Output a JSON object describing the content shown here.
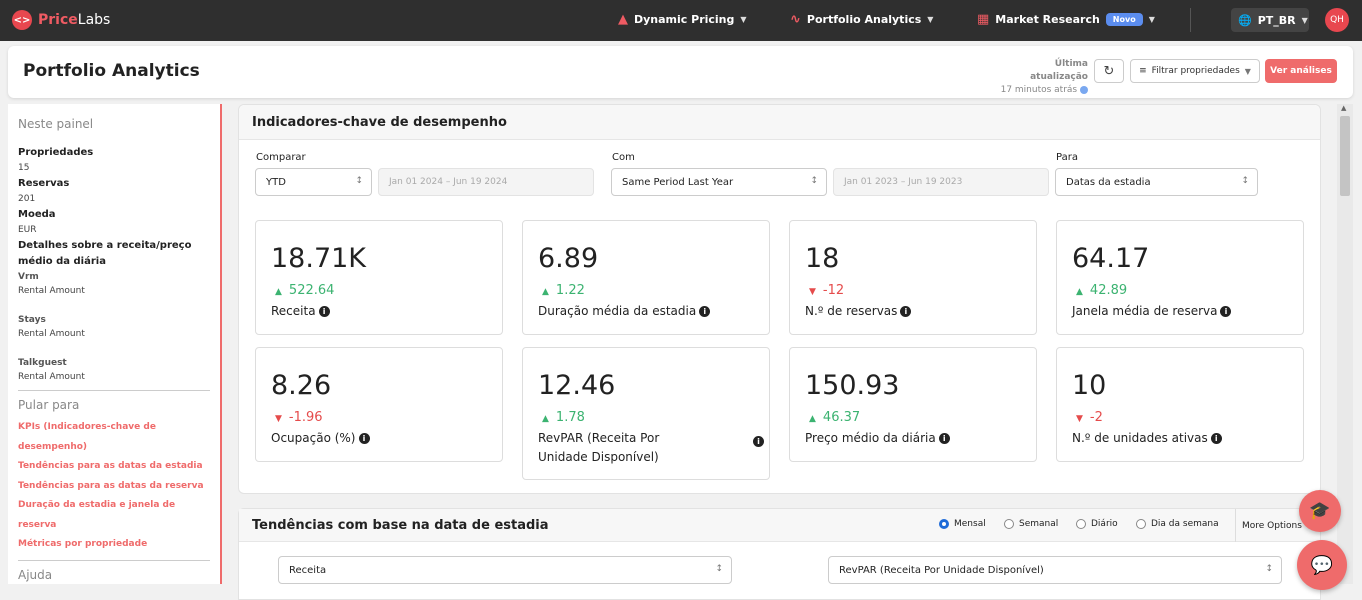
{
  "nav": {
    "brand_price": "Price",
    "brand_labs": "Labs",
    "dynamic_pricing": "Dynamic Pricing",
    "portfolio_analytics": "Portfolio Analytics",
    "market_research": "Market Research",
    "new_badge": "Novo",
    "language": "PT_BR",
    "avatar": "QH"
  },
  "header": {
    "title": "Portfolio Analytics",
    "last_update_label": "Última atualização",
    "last_update_value": "17 minutos atrás",
    "filter_label": "Filtrar propriedades",
    "view_analyses_label": "Ver análises"
  },
  "sidebar": {
    "in_panel": "Neste painel",
    "properties_label": "Propriedades",
    "properties_value": "15",
    "bookings_label": "Reservas",
    "bookings_value": "201",
    "currency_label": "Moeda",
    "currency_value": "EUR",
    "revenue_details_label": "Detalhes sobre a receita/preço médio da diária",
    "sources": [
      {
        "name": "Vrm",
        "value": "Rental Amount"
      },
      {
        "name": "Stays",
        "value": "Rental Amount"
      },
      {
        "name": "Talkguest",
        "value": "Rental Amount"
      }
    ],
    "jump_to": "Pular para",
    "links": [
      "KPIs (Indicadores-chave de desempenho)",
      "Tendências para as datas da estadia",
      "Tendências para as datas da reserva",
      "Duração da estadia e janela de reserva",
      "Métricas por propriedade"
    ],
    "help": "Ajuda"
  },
  "kpi_section": {
    "title": "Indicadores-chave de desempenho",
    "compare_label": "Comparar",
    "compare_value": "YTD",
    "compare_range": "Jan 01 2024 – Jun 19 2024",
    "with_label": "Com",
    "with_value": "Same Period Last Year",
    "with_range": "Jan 01 2023 – Jun 19 2023",
    "for_label": "Para",
    "for_value": "Datas da estadia",
    "cards": [
      {
        "value": "18.71K",
        "delta": "522.64",
        "dir": "up",
        "name": "Receita"
      },
      {
        "value": "6.89",
        "delta": "1.22",
        "dir": "up",
        "name": "Duração média da estadia"
      },
      {
        "value": "18",
        "delta": "-12",
        "dir": "down",
        "name": "N.º de reservas"
      },
      {
        "value": "64.17",
        "delta": "42.89",
        "dir": "up",
        "name": "Janela média de reserva"
      },
      {
        "value": "8.26",
        "delta": "-1.96",
        "dir": "down",
        "name": "Ocupação (%)"
      },
      {
        "value": "12.46",
        "delta": "1.78",
        "dir": "up",
        "name": "RevPAR (Receita Por Unidade Disponível)"
      },
      {
        "value": "150.93",
        "delta": "46.37",
        "dir": "up",
        "name": "Preço médio da diária"
      },
      {
        "value": "10",
        "delta": "-2",
        "dir": "down",
        "name": "N.º de unidades ativas"
      }
    ]
  },
  "trends_section": {
    "title": "Tendências com base na data de estadia",
    "options": [
      "Mensal",
      "Semanal",
      "Diário",
      "Dia da semana"
    ],
    "selected": "Mensal",
    "more_options": "More Options",
    "left_metric": "Receita",
    "right_metric": "RevPAR (Receita Por Unidade Disponível)"
  },
  "colors": {
    "accent": "#ef6b6b",
    "nav_bg": "#2f2f2f",
    "positive": "#3cb371",
    "negative": "#e54b4b"
  }
}
